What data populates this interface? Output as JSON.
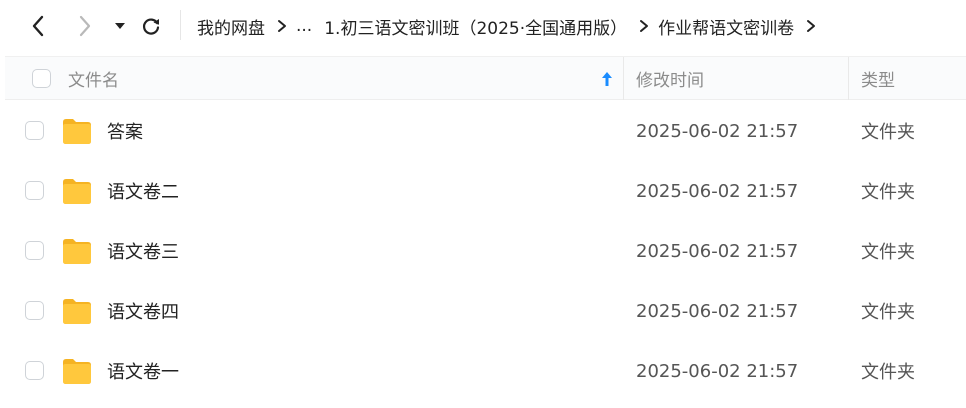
{
  "breadcrumb": [
    "我的网盘",
    "...",
    "1.初三语文密训班（2025·全国通用版）",
    "作业帮语文密训卷"
  ],
  "header": {
    "name": "文件名",
    "modified": "修改时间",
    "type": "类型"
  },
  "rows": [
    {
      "name": "答案",
      "date": "2025-06-02 21:57",
      "type": "文件夹"
    },
    {
      "name": "语文卷二",
      "date": "2025-06-02 21:57",
      "type": "文件夹"
    },
    {
      "name": "语文卷三",
      "date": "2025-06-02 21:57",
      "type": "文件夹"
    },
    {
      "name": "语文卷四",
      "date": "2025-06-02 21:57",
      "type": "文件夹"
    },
    {
      "name": "语文卷一",
      "date": "2025-06-02 21:57",
      "type": "文件夹"
    }
  ],
  "colors": {
    "folder": "#ffc83d",
    "sort_arrow": "#1a8cff"
  }
}
